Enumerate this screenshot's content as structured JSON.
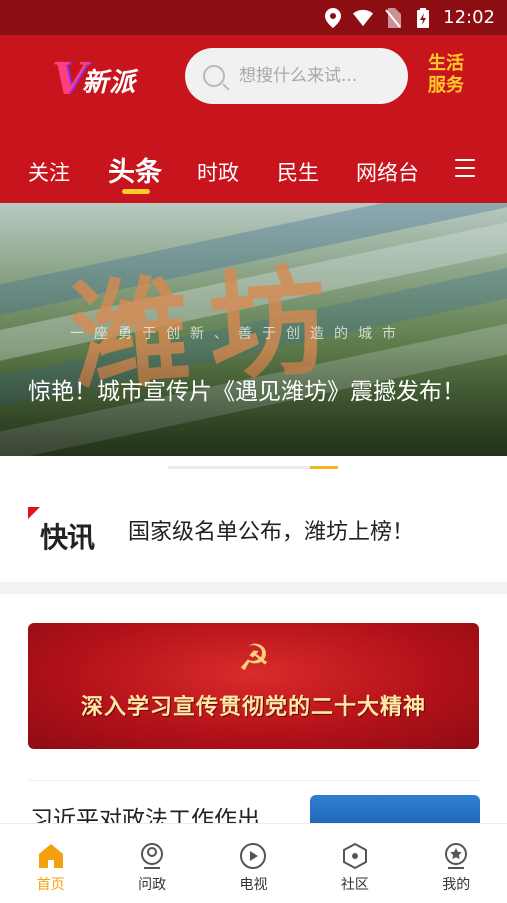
{
  "status_bar": {
    "time": "12:02"
  },
  "header": {
    "logo_mark": "V",
    "logo_text": "新派",
    "search_placeholder": "想搜什么来试...",
    "service_label_line1": "生活",
    "service_label_line2": "服务"
  },
  "tabs": [
    {
      "label": "关注",
      "active": false
    },
    {
      "label": "头条",
      "active": true
    },
    {
      "label": "时政",
      "active": false
    },
    {
      "label": "民生",
      "active": false
    },
    {
      "label": "网络台",
      "active": false
    }
  ],
  "hero": {
    "overlay_text": "潍坊",
    "overlay_slogan": "一座勇于创新、善于创造的城市",
    "caption": "惊艳！城市宣传片《遇见潍坊》震撼发布！"
  },
  "flash": {
    "badge": "快讯",
    "headline": "国家级名单公布，潍坊上榜！"
  },
  "banner": {
    "slogan": "深入学习宣传贯彻党的二十大精神"
  },
  "news": {
    "title": "习近平对政法工作作出"
  },
  "bottom_nav": [
    {
      "label": "首页",
      "icon": "home-icon",
      "active": true
    },
    {
      "label": "问政",
      "icon": "user-badge-icon",
      "active": false
    },
    {
      "label": "电视",
      "icon": "play-icon",
      "active": false
    },
    {
      "label": "社区",
      "icon": "hexagon-icon",
      "active": false
    },
    {
      "label": "我的",
      "icon": "star-user-icon",
      "active": false
    }
  ],
  "colors": {
    "brand_red": "#c8141c",
    "status_red": "#8c0d12",
    "accent_yellow": "#ffc928",
    "active_orange": "#f5a10f"
  }
}
